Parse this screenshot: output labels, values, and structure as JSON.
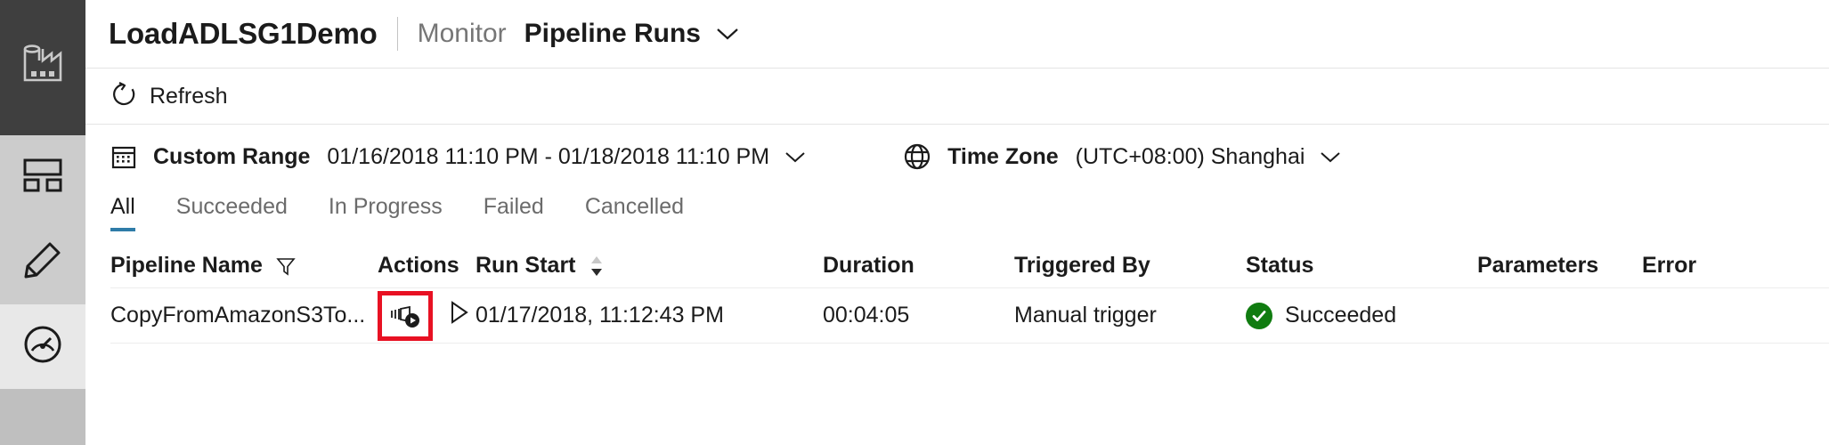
{
  "rail": {
    "logo_icon": "data-factory-logo-icon",
    "items": [
      {
        "icon": "dashboard-overview-icon",
        "selected": false
      },
      {
        "icon": "pencil-author-icon",
        "selected": false
      },
      {
        "icon": "gauge-monitor-icon",
        "selected": true
      }
    ]
  },
  "header": {
    "app_title": "LoadADLSG1Demo",
    "breadcrumb_section": "Monitor",
    "breadcrumb_current": "Pipeline Runs",
    "chevron_icon": "chevron-down-icon"
  },
  "toolbar": {
    "refresh_label": "Refresh",
    "refresh_icon": "refresh-icon"
  },
  "filters": {
    "range_icon": "calendar-icon",
    "range_label": "Custom Range",
    "range_value": "01/16/2018 11:10 PM - 01/18/2018 11:10 PM",
    "range_chevron_icon": "chevron-down-icon",
    "timezone_icon": "globe-icon",
    "timezone_label": "Time Zone",
    "timezone_value": "(UTC+08:00) Shanghai",
    "timezone_chevron_icon": "chevron-down-icon"
  },
  "tabs": [
    {
      "label": "All",
      "active": true
    },
    {
      "label": "Succeeded",
      "active": false
    },
    {
      "label": "In Progress",
      "active": false
    },
    {
      "label": "Failed",
      "active": false
    },
    {
      "label": "Cancelled",
      "active": false
    }
  ],
  "table": {
    "columns": [
      {
        "key": "name",
        "label": "Pipeline Name",
        "icon": "filter-funnel-icon"
      },
      {
        "key": "actions",
        "label": "Actions",
        "icon": ""
      },
      {
        "key": "runstart",
        "label": "Run Start",
        "icon": "sort-arrows-icon"
      },
      {
        "key": "duration",
        "label": "Duration",
        "icon": ""
      },
      {
        "key": "trigger",
        "label": "Triggered By",
        "icon": ""
      },
      {
        "key": "status",
        "label": "Status",
        "icon": ""
      },
      {
        "key": "params",
        "label": "Parameters",
        "icon": ""
      },
      {
        "key": "error",
        "label": "Error",
        "icon": ""
      }
    ],
    "rows": [
      {
        "name": "CopyFromAmazonS3To...",
        "action_view_icon": "view-activity-runs-icon",
        "action_rerun_icon": "rerun-play-icon",
        "runstart": "01/17/2018, 11:12:43 PM",
        "duration": "00:04:05",
        "trigger": "Manual trigger",
        "status": "Succeeded",
        "status_icon": "success-check-icon",
        "params": "",
        "error": ""
      }
    ]
  },
  "colors": {
    "accent_tab_underline": "#2f7ca8",
    "status_success": "#107c10",
    "highlight_box": "#e81123",
    "rail_logo_bg": "#3f3f3f",
    "rail_bg": "#cccccc",
    "rail_selected_bg": "#e8e8e8"
  }
}
